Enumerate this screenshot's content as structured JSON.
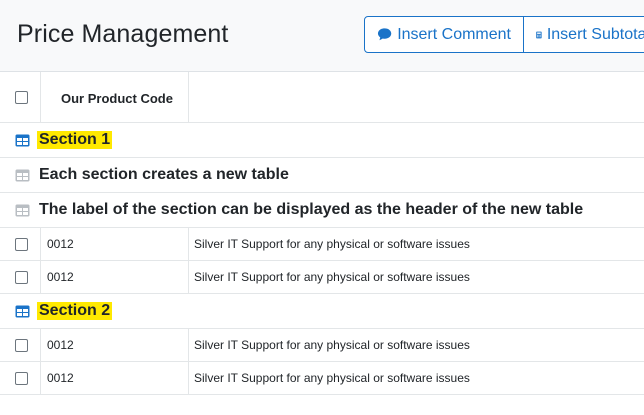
{
  "page": {
    "title": "Price Management"
  },
  "toolbar": {
    "insert_comment": "Insert Comment",
    "insert_subtotal": "Insert Subtotal"
  },
  "table": {
    "columns": [
      "Our Product Code"
    ],
    "rows": [
      {
        "kind": "section",
        "label": "Section 1",
        "highlight": true
      },
      {
        "kind": "text",
        "label": "Each section creates a new table"
      },
      {
        "kind": "text",
        "label": "The label of the section can be displayed as the header of the new table"
      },
      {
        "kind": "item",
        "code": "0012",
        "description": "Silver IT Support for any physical or software issues"
      },
      {
        "kind": "item",
        "code": "0012",
        "description": "Silver IT Support for any physical or software issues"
      },
      {
        "kind": "section",
        "label": "Section 2",
        "highlight": true
      },
      {
        "kind": "item",
        "code": "0012",
        "description": "Silver IT Support for any physical or software issues"
      },
      {
        "kind": "item",
        "code": "0012",
        "description": "Silver IT Support for any physical or software issues"
      }
    ]
  },
  "colors": {
    "accent": "#1a73c8",
    "highlight": "#ffe900",
    "section_icon": "#1a73c8",
    "text_icon": "#b9bec3"
  }
}
